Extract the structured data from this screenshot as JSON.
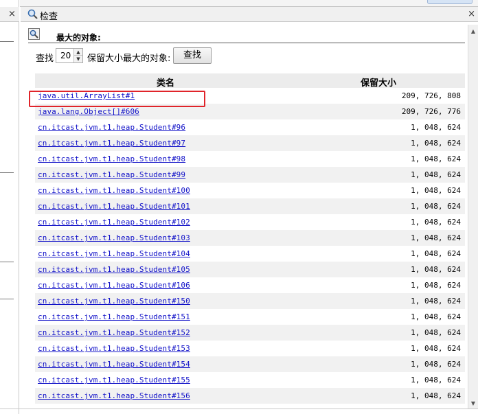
{
  "left_panel": {
    "close_glyph": "×"
  },
  "panel": {
    "title": "检查",
    "close_glyph": "×",
    "section_title": "最大的对象:",
    "search": {
      "label": "查找",
      "count_value": "20",
      "suffix": "保留大小最大的对象:",
      "button_label": "查找"
    },
    "table": {
      "columns": [
        "类名",
        "保留大小"
      ],
      "rows": [
        {
          "name": "java.util.ArrayList#1",
          "size": "209, 726, 808"
        },
        {
          "name": "java.lang.Object[]#606",
          "size": "209, 726, 776"
        },
        {
          "name": "cn.itcast.jvm.t1.heap.Student#96",
          "size": "1, 048, 624"
        },
        {
          "name": "cn.itcast.jvm.t1.heap.Student#97",
          "size": "1, 048, 624"
        },
        {
          "name": "cn.itcast.jvm.t1.heap.Student#98",
          "size": "1, 048, 624"
        },
        {
          "name": "cn.itcast.jvm.t1.heap.Student#99",
          "size": "1, 048, 624"
        },
        {
          "name": "cn.itcast.jvm.t1.heap.Student#100",
          "size": "1, 048, 624"
        },
        {
          "name": "cn.itcast.jvm.t1.heap.Student#101",
          "size": "1, 048, 624"
        },
        {
          "name": "cn.itcast.jvm.t1.heap.Student#102",
          "size": "1, 048, 624"
        },
        {
          "name": "cn.itcast.jvm.t1.heap.Student#103",
          "size": "1, 048, 624"
        },
        {
          "name": "cn.itcast.jvm.t1.heap.Student#104",
          "size": "1, 048, 624"
        },
        {
          "name": "cn.itcast.jvm.t1.heap.Student#105",
          "size": "1, 048, 624"
        },
        {
          "name": "cn.itcast.jvm.t1.heap.Student#106",
          "size": "1, 048, 624"
        },
        {
          "name": "cn.itcast.jvm.t1.heap.Student#150",
          "size": "1, 048, 624"
        },
        {
          "name": "cn.itcast.jvm.t1.heap.Student#151",
          "size": "1, 048, 624"
        },
        {
          "name": "cn.itcast.jvm.t1.heap.Student#152",
          "size": "1, 048, 624"
        },
        {
          "name": "cn.itcast.jvm.t1.heap.Student#153",
          "size": "1, 048, 624"
        },
        {
          "name": "cn.itcast.jvm.t1.heap.Student#154",
          "size": "1, 048, 624"
        },
        {
          "name": "cn.itcast.jvm.t1.heap.Student#155",
          "size": "1, 048, 624"
        },
        {
          "name": "cn.itcast.jvm.t1.heap.Student#156",
          "size": "1, 048, 624"
        }
      ]
    }
  },
  "colors": {
    "link": "#1010c8",
    "highlight": "#e0242a",
    "header_bg": "#f0f0f0",
    "row_alt": "#f1f1f1"
  }
}
